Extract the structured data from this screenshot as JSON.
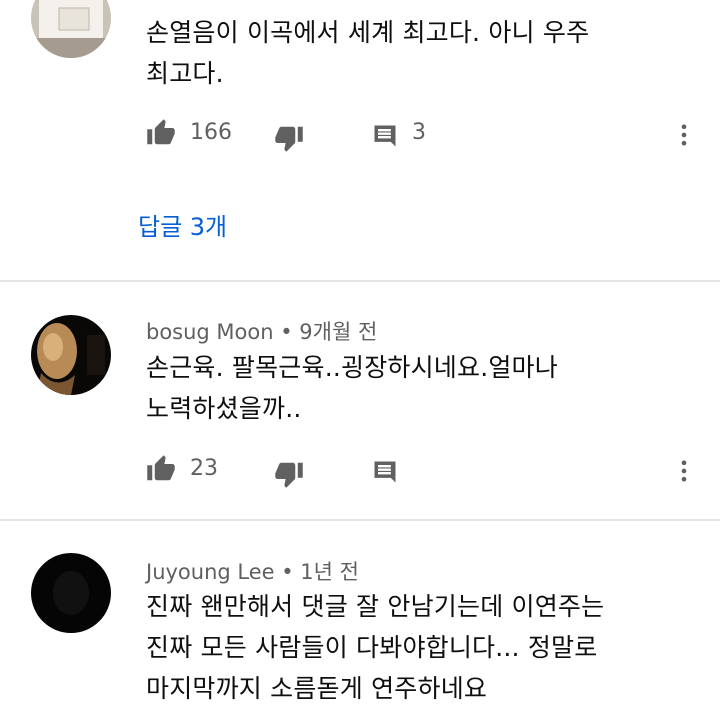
{
  "comments": [
    {
      "meta": "",
      "text_lines": [
        "손열음이 이곡에서 세계 최고다. 아니 우주",
        "최고다."
      ],
      "likes": "166",
      "replies_count": "3",
      "replies_link": "답글 3개"
    },
    {
      "meta": "bosug Moon • 9개월 전",
      "text_lines": [
        "손근육. 팔목근육..굉장하시네요.얼마나",
        "노력하셨을까.."
      ],
      "likes": "23",
      "replies_count": ""
    },
    {
      "meta": "Juyoung Lee • 1년 전",
      "text_lines": [
        "진짜 왠만해서 댓글 잘 안남기는데 이연주는",
        "진짜 모든 사람들이 다봐야합니다... 정말로",
        "마지막까지 소름돋게 연주하네요"
      ]
    }
  ],
  "icons": {
    "like": "thumbs-up-icon",
    "dislike": "thumbs-down-icon",
    "reply": "comment-icon",
    "more": "more-vert-icon"
  },
  "colors": {
    "link": "#065fd4",
    "icon": "#606060",
    "divider": "#e5e5e5"
  }
}
